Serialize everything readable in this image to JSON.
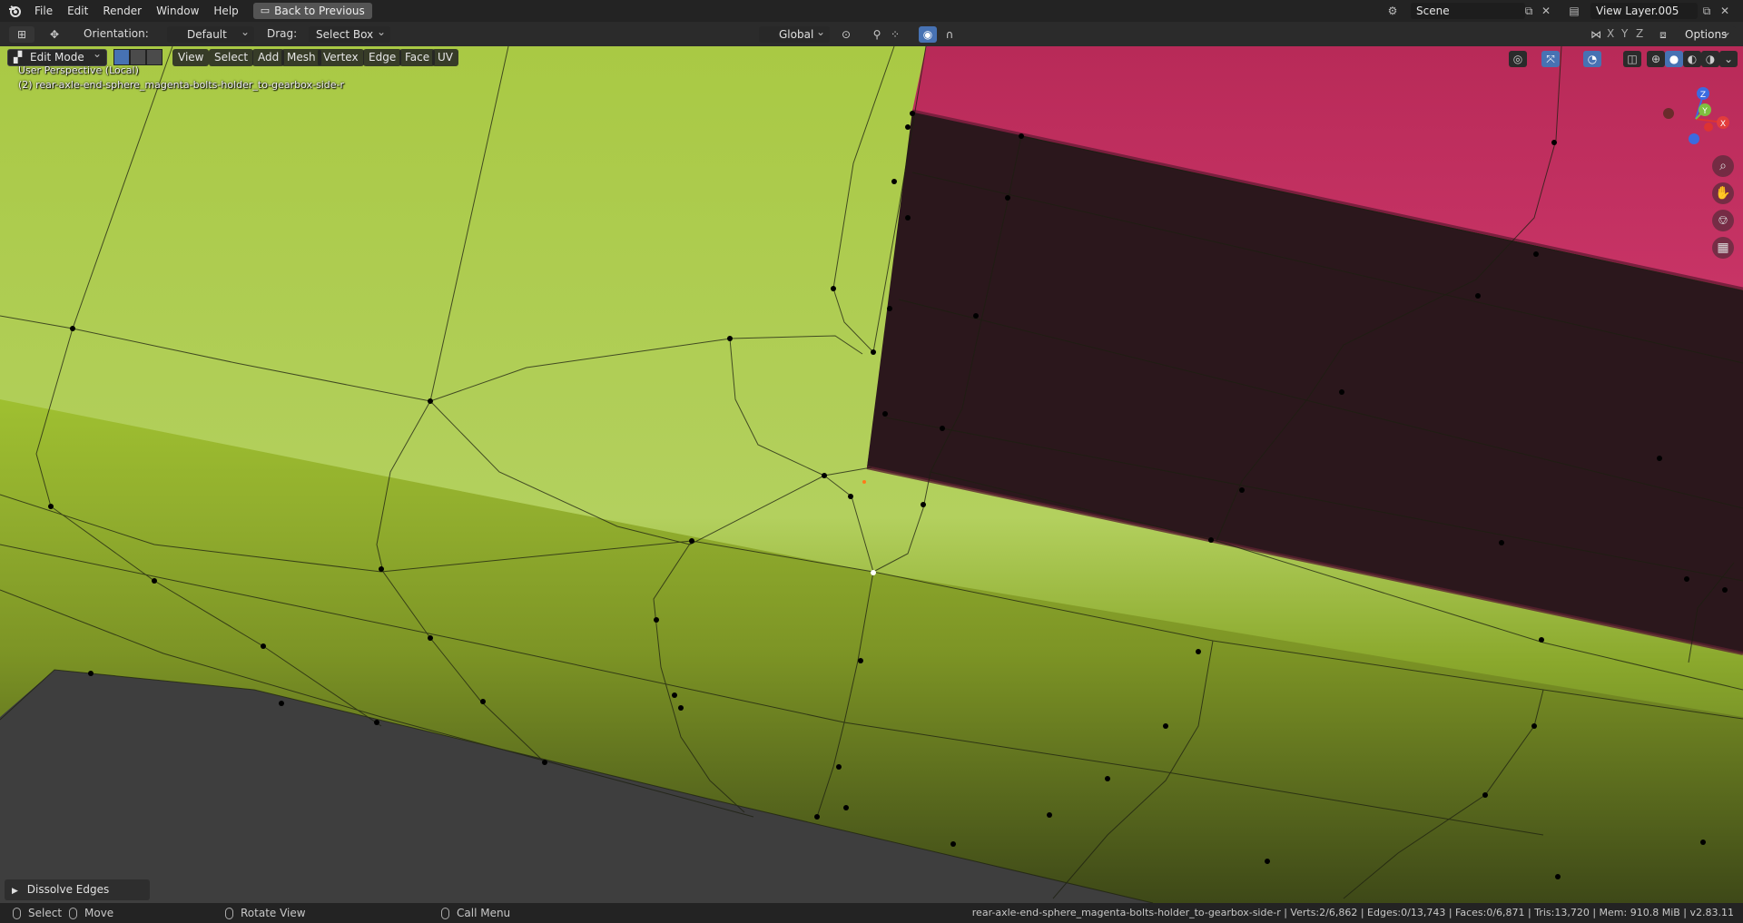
{
  "menu": {
    "items": [
      "File",
      "Edit",
      "Render",
      "Window",
      "Help"
    ],
    "back_button": "Back to Previous"
  },
  "scene": {
    "name": "Scene",
    "view_layer": "View Layer.005"
  },
  "toolbar": {
    "orientation_label": "Orientation:",
    "orientation_value": "Default",
    "drag_label": "Drag:",
    "drag_value": "Select Box",
    "transform_orientation": "Global",
    "axes": [
      "X",
      "Y",
      "Z"
    ],
    "options_label": "Options"
  },
  "viewport_header": {
    "mode": "Edit Mode",
    "menus": [
      "View",
      "Select",
      "Add",
      "Mesh",
      "Vertex",
      "Edge",
      "Face",
      "UV"
    ]
  },
  "viewport": {
    "perspective_text": "User Perspective (Local)",
    "object_text": "(2) rear-axle-end-sphere_magenta-bolts-holder_to-gearbox-side-r",
    "gizmo_axes": {
      "x": "X",
      "y": "Y",
      "z": "Z"
    }
  },
  "last_operator": "Dissolve Edges",
  "statusbar": {
    "select": "Select",
    "move": "Move",
    "rotate_view": "Rotate View",
    "call_menu": "Call Menu",
    "stats": "rear-axle-end-sphere_magenta-bolts-holder_to-gearbox-side-r | Verts:2/6,862 | Edges:0/13,743 | Faces:0/6,871 | Tris:13,720 | Mem: 910.8 MiB | v2.83.11"
  },
  "colors": {
    "mesh_green": "#a8c83a",
    "mesh_green_dark": "#4a5522",
    "mesh_magenta": "#c2305f",
    "mesh_magenta_dark": "#2a161c",
    "accent_blue": "#4772b3",
    "background": "#3e3e3e"
  },
  "icons": {
    "logo": "blender-logo-icon",
    "nav": [
      "zoom-icon",
      "hand-icon",
      "camera-icon",
      "grid-icon"
    ]
  }
}
